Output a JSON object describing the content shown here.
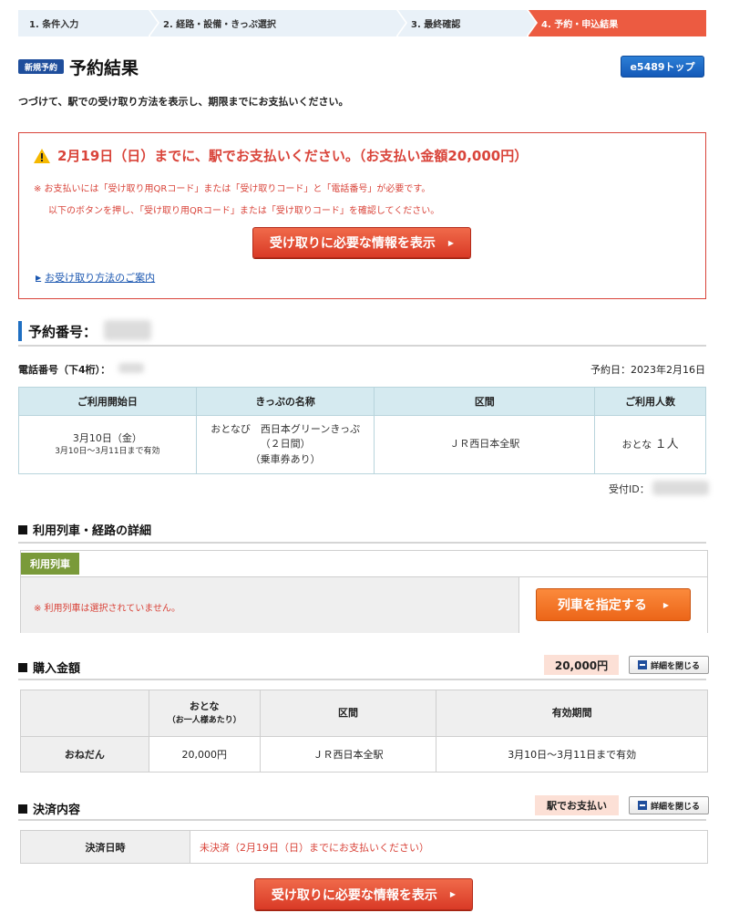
{
  "steps": [
    {
      "label": "1.  条件入力"
    },
    {
      "label": "2.  経路・設備・きっぷ選択"
    },
    {
      "label": "3.  最終確認"
    },
    {
      "label": "4.  予約・申込結果"
    }
  ],
  "header": {
    "badge": "新規予約",
    "title": "予約結果",
    "top_button": "e5489トップ",
    "intro": "つづけて、駅での受け取り方法を表示し、期限までにお支払いください。"
  },
  "alert": {
    "title": "2月19日（日）までに、駅でお支払いください。（お支払い金額20,000円）",
    "note1": "※ お支払いには「受け取り用QRコード」または「受け取りコード」と「電話番号」が必要です。",
    "note2": "以下のボタンを押し、「受け取り用QRコード」または「受け取りコード」を確認してください。",
    "button": "受け取りに必要な情報を表示",
    "link": "お受け取り方法のご案内"
  },
  "reservation": {
    "number_label": "予約番号：",
    "tel_label": "電話番号（下4桁）：",
    "date": "予約日：2023年2月16日",
    "receipt_id_label": "受付ID："
  },
  "ticket_table": {
    "headers": [
      "ご利用開始日",
      "きっぷの名称",
      "区間",
      "ご利用人数"
    ],
    "start_date": "3月10日（金）",
    "valid_range": "3月10日～3月11日まで有効",
    "ticket_name_1": "おとなび　西日本グリーンきっぷ",
    "ticket_name_2": "（２日間）",
    "ticket_name_3": "（乗車券あり）",
    "section": "ＪＲ西日本全駅",
    "people_prefix": "おとな",
    "people_count": "１人"
  },
  "train": {
    "heading": "利用列車・経路の詳細",
    "tag": "利用列車",
    "note": "※ 利用列車は選択されていません。",
    "button": "列車を指定する"
  },
  "purchase": {
    "heading": "購入金額",
    "amount": "20,000円",
    "detail_button": "詳細を閉じる",
    "col_adult": "おとな",
    "col_adult_sub": "（お一人様あたり）",
    "col_section": "区間",
    "col_validity": "有効期間",
    "row_label": "おねだん",
    "price": "20,000円",
    "section": "ＪＲ西日本全駅",
    "validity": "3月10日～3月11日まで有効"
  },
  "payment": {
    "heading": "決済内容",
    "method": "駅でお支払い",
    "detail_button": "詳細を閉じる",
    "row_label": "決済日時",
    "status": "未決済（2月19日（日）までにお支払いください）"
  },
  "bottom_button": "受け取りに必要な情報を表示",
  "colors": {
    "accent_red": "#d9443a",
    "step_active": "#ec5b41",
    "brand_blue": "#1f4e9c",
    "train_green": "#7a9a3a",
    "orange": "#ec6518"
  }
}
